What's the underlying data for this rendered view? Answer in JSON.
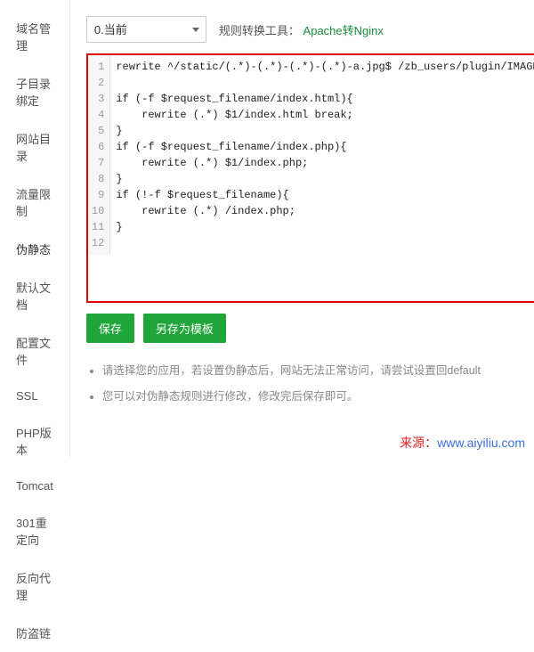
{
  "sidebar": {
    "items": [
      {
        "label": "域名管理"
      },
      {
        "label": "子目录绑定"
      },
      {
        "label": "网站目录"
      },
      {
        "label": "流量限制"
      },
      {
        "label": "伪静态",
        "active": true
      },
      {
        "label": "默认文档"
      },
      {
        "label": "配置文件"
      },
      {
        "label": "SSL"
      },
      {
        "label": "PHP版本"
      },
      {
        "label": "Tomcat"
      },
      {
        "label": "301重定向"
      },
      {
        "label": "反向代理"
      },
      {
        "label": "防盗链"
      }
    ]
  },
  "top": {
    "select_value": "0.当前",
    "tool_label": "规则转换工具：",
    "tool_link": "Apache转Nginx"
  },
  "code_lines": [
    "rewrite ^/static/(.*)-(.*)-(.*)-(.*)-a.jpg$ /zb_users/plugin/IMAGE/pic.php;",
    "",
    "if (-f $request_filename/index.html){",
    "    rewrite (.*) $1/index.html break;",
    "}",
    "if (-f $request_filename/index.php){",
    "    rewrite (.*) $1/index.php;",
    "}",
    "if (!-f $request_filename){",
    "    rewrite (.*) /index.php;",
    "}",
    ""
  ],
  "buttons": {
    "save": "保存",
    "save_as_template": "另存为模板"
  },
  "hints": [
    "请选择您的应用，若设置伪静态后，网站无法正常访问，请尝试设置回default",
    "您可以对伪静态规则进行修改，修改完后保存即可。"
  ],
  "source": {
    "prefix": "来源：",
    "url_text": "www.aiyiliu.com"
  }
}
